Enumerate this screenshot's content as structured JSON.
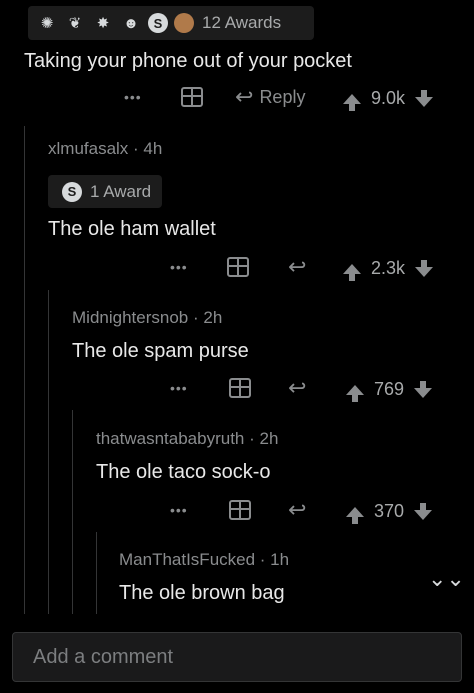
{
  "top_comment": {
    "awards_label": "12 Awards",
    "award_icons": [
      "wholesome-icon",
      "hugz-icon",
      "mindblown-icon",
      "laughing-icon",
      "silver-icon",
      "bear-icon"
    ],
    "text": "Taking your phone out of your pocket",
    "reply_label": "Reply",
    "score": "9.0k"
  },
  "replies": [
    {
      "author": "xlmufasalx",
      "age": "4h",
      "award_label": "1 Award",
      "text": "The ole ham wallet",
      "score": "2.3k"
    },
    {
      "author": "Midnightersnob",
      "age": "2h",
      "text": "The ole spam purse",
      "score": "769"
    },
    {
      "author": "thatwasntababyruth",
      "age": "2h",
      "text": "The ole taco sock-o",
      "score": "370"
    },
    {
      "author": "ManThatIsFucked",
      "age": "1h",
      "text": "The ole brown bag"
    }
  ],
  "composer": {
    "placeholder": "Add a comment"
  },
  "icons": {
    "more": "more-icon",
    "gift": "gift-icon",
    "reply": "reply-icon",
    "upvote": "upvote-icon",
    "downvote": "downvote-icon",
    "collapse": "collapse-icon"
  }
}
